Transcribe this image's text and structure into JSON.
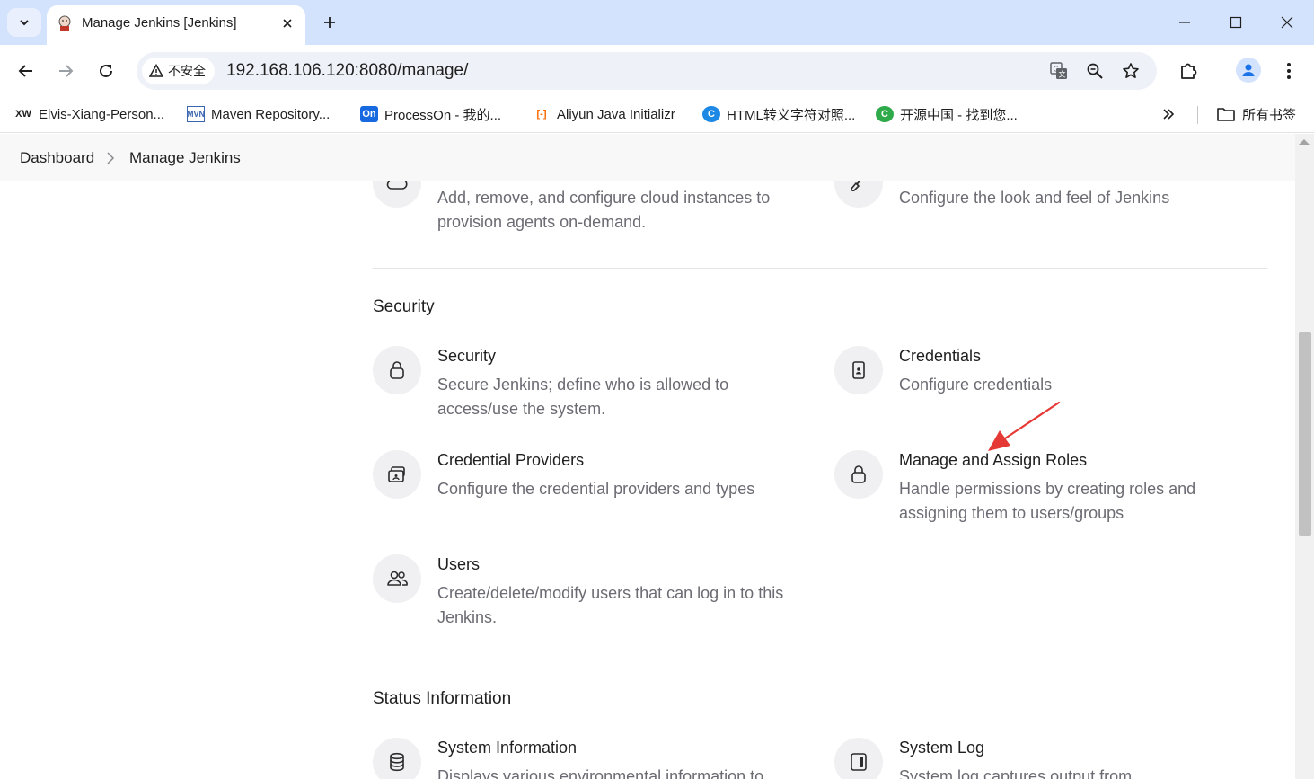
{
  "browser": {
    "tab_title": "Manage Jenkins [Jenkins]",
    "security_chip": "不安全",
    "url": "192.168.106.120:8080/manage/",
    "bookmarks": [
      {
        "icon_text": "XW",
        "label": "Elvis-Xiang-Person..."
      },
      {
        "icon_text": "MVN",
        "label": "Maven Repository..."
      },
      {
        "icon_text": "On",
        "label": "ProcessOn - 我的..."
      },
      {
        "icon_text": "[-]",
        "label": "Aliyun Java Initializr"
      },
      {
        "icon_text": "C",
        "label": "HTML转义字符对照..."
      },
      {
        "icon_text": "C",
        "label": "开源中国 - 找到您..."
      }
    ],
    "all_bookmarks": "所有书签",
    "colors": {
      "tabstrip": "#d3e3fd",
      "accent": "#1a73e8"
    }
  },
  "breadcrumb": {
    "dashboard": "Dashboard",
    "current": "Manage Jenkins"
  },
  "partial_top": {
    "clouds_desc": "Add, remove, and configure cloud instances to provision agents on-demand.",
    "appearance_desc": "Configure the look and feel of Jenkins"
  },
  "security_section": {
    "title": "Security",
    "items": [
      {
        "icon": "lock-icon",
        "title": "Security",
        "desc": "Secure Jenkins; define who is allowed to access/use the system."
      },
      {
        "icon": "id-card-icon",
        "title": "Credentials",
        "desc": "Configure credentials"
      },
      {
        "icon": "credential-providers-icon",
        "title": "Credential Providers",
        "desc": "Configure the credential providers and types"
      },
      {
        "icon": "lock-icon",
        "title": "Manage and Assign Roles",
        "desc": "Handle permissions by creating roles and assigning them to users/groups"
      },
      {
        "icon": "users-icon",
        "title": "Users",
        "desc": "Create/delete/modify users that can log in to this Jenkins."
      }
    ]
  },
  "status_section": {
    "title": "Status Information",
    "items": [
      {
        "icon": "database-icon",
        "title": "System Information",
        "desc": "Displays various environmental information to"
      },
      {
        "icon": "log-panel-icon",
        "title": "System Log",
        "desc": "System log captures output from"
      }
    ]
  },
  "annotation_color": "#e53935"
}
